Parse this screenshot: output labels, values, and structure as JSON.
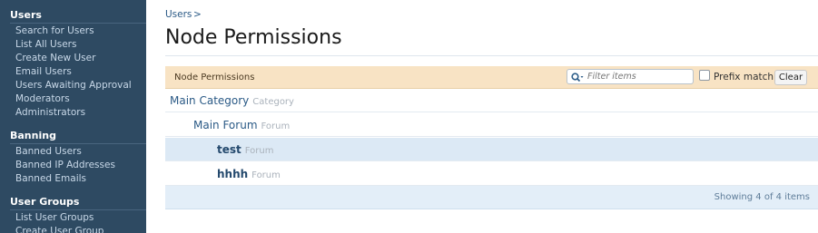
{
  "sidebar": {
    "sections": [
      {
        "heading": "Users",
        "links": [
          "Search for Users",
          "List All Users",
          "Create New User",
          "Email Users",
          "Users Awaiting Approval",
          "Moderators",
          "Administrators"
        ]
      },
      {
        "heading": "Banning",
        "links": [
          "Banned Users",
          "Banned IP Addresses",
          "Banned Emails"
        ]
      },
      {
        "heading": "User Groups",
        "links": [
          "List User Groups",
          "Create User Group"
        ]
      }
    ]
  },
  "main": {
    "breadcrumb": "Users",
    "breadcrumb_sep": ">",
    "title": "Node Permissions",
    "bar_label": "Node Permissions",
    "filter_placeholder": "Filter items",
    "prefix_match_label": "Prefix match",
    "clear_label": "Clear",
    "nodes": [
      {
        "name": "Main Category",
        "type": "Category",
        "depth": 0,
        "selected": false,
        "bold": false
      },
      {
        "name": "Main Forum",
        "type": "Forum",
        "depth": 1,
        "selected": false,
        "bold": false
      },
      {
        "name": "test",
        "type": "Forum",
        "depth": 2,
        "selected": true,
        "bold": true
      },
      {
        "name": "hhhh",
        "type": "Forum",
        "depth": 2,
        "selected": false,
        "bold": true
      }
    ],
    "showing_text": "Showing 4 of 4 items"
  },
  "colors": {
    "sidebar_bg": "#2e4a62",
    "bar_bg": "#f8e3c4",
    "selected_row_bg": "#dce9f5",
    "link": "#2b5a86"
  }
}
